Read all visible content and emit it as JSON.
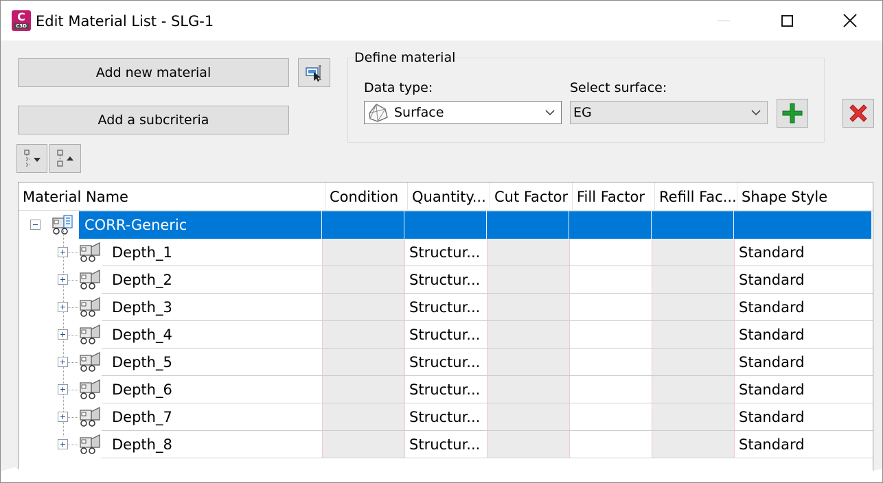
{
  "window": {
    "title": "Edit Material List - SLG-1",
    "app_icon": {
      "letter": "C",
      "badge": "C3D",
      "name": "civil3d-app-icon"
    },
    "controls": [
      "minimize-icon",
      "maximize-icon",
      "close-icon"
    ]
  },
  "toolbar": {
    "add_material_label": "Add new material",
    "add_subcriteria_label": "Add a subcriteria",
    "pick_icon": "pick-from-drawing-icon",
    "expand_all_icon": "expand-all-icon",
    "collapse_all_icon": "collapse-all-icon"
  },
  "define_material": {
    "group_label": "Define material",
    "data_type_label": "Data type:",
    "data_type_value": "Surface",
    "select_surface_label": "Select surface:",
    "surface_value": "EG",
    "add_icon": "green-plus-icon",
    "delete_icon": "red-x-icon"
  },
  "grid": {
    "columns": [
      "Material Name",
      "Condition",
      "Quantity...",
      "Cut Factor",
      "Fill Factor",
      "Refill Fac...",
      "Shape Style"
    ],
    "root": {
      "name": "CORR-Generic",
      "selected": true,
      "expanded": true
    },
    "rows": [
      {
        "name": "Depth_1",
        "quantity": "Structur...",
        "shape_style": "Standard"
      },
      {
        "name": "Depth_2",
        "quantity": "Structur...",
        "shape_style": "Standard"
      },
      {
        "name": "Depth_3",
        "quantity": "Structur...",
        "shape_style": "Standard"
      },
      {
        "name": "Depth_4",
        "quantity": "Structur...",
        "shape_style": "Standard"
      },
      {
        "name": "Depth_5",
        "quantity": "Structur...",
        "shape_style": "Standard"
      },
      {
        "name": "Depth_6",
        "quantity": "Structur...",
        "shape_style": "Standard"
      },
      {
        "name": "Depth_7",
        "quantity": "Structur...",
        "shape_style": "Standard"
      },
      {
        "name": "Depth_8",
        "quantity": "Structur...",
        "shape_style": "Standard"
      }
    ]
  },
  "colors": {
    "selection": "#0078d7",
    "accent_app": "#c21a6d",
    "add_green": "#1e9e2e",
    "delete_red": "#e03030"
  }
}
